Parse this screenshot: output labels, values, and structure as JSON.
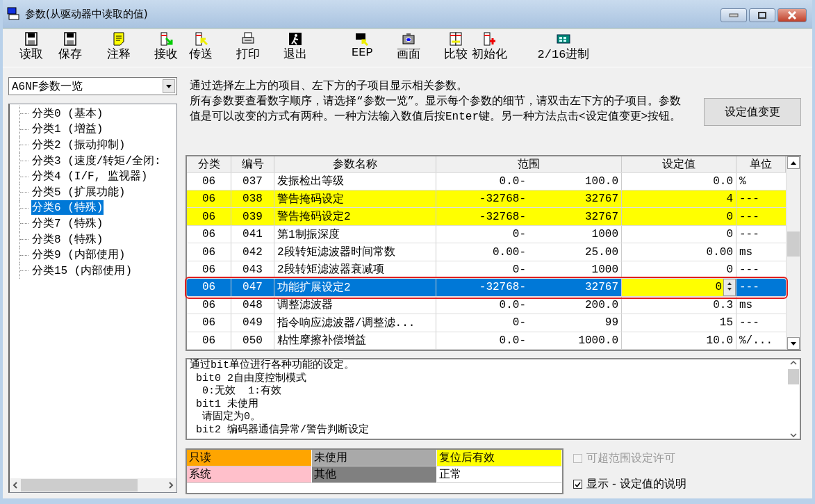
{
  "window": {
    "title": "参数(从驱动器中读取的值)"
  },
  "toolbar": [
    "读取",
    "保存",
    "注释",
    "接收",
    "传送",
    "打印",
    "退出",
    "EEP",
    "画面",
    "比较",
    "初始化",
    "2/16进制"
  ],
  "sidebar": {
    "dropdown": "A6NF参数一览",
    "tree": [
      {
        "label": "分类0 (基本)",
        "selected": false
      },
      {
        "label": "分类1 (增益)",
        "selected": false
      },
      {
        "label": "分类2 (振动抑制)",
        "selected": false
      },
      {
        "label": "分类3 (速度/转矩/全闭:",
        "selected": false
      },
      {
        "label": "分类4 (I/F, 监视器)",
        "selected": false
      },
      {
        "label": "分类5 (扩展功能)",
        "selected": false
      },
      {
        "label": "分类6 (特殊)",
        "selected": true
      },
      {
        "label": "分类7 (特殊)",
        "selected": false
      },
      {
        "label": "分类8 (特殊)",
        "selected": false
      },
      {
        "label": "分类9 (内部使用)",
        "selected": false
      },
      {
        "label": "分类15 (内部使用)",
        "selected": false
      }
    ]
  },
  "instructions": [
    "通过选择左上方的项目、左下方的子项目显示相关参数。",
    "所有参数要查看数字顺序，请选择“参数一览”。显示每个参数的细节，请双击左下方的子项目。参数值是可以改变的方式有两种。一种方法输入数值后按Enter键。另一种方法点击<设定值变更>按钮。"
  ],
  "change_button": "设定值变更",
  "table": {
    "columns": [
      "分类",
      "编号",
      "参数名称",
      "范围",
      "设定值",
      "单位"
    ],
    "rows": [
      {
        "group": "06",
        "number": "037",
        "name": "发振检出等级",
        "min": "0.0-",
        "max": "100.0",
        "value": "0.0",
        "unit": "%",
        "reset_effective": false,
        "selected": false
      },
      {
        "group": "06",
        "number": "038",
        "name": "警告掩码设定",
        "min": "-32768-",
        "max": "32767",
        "value": "4",
        "unit": "---",
        "reset_effective": true,
        "selected": false
      },
      {
        "group": "06",
        "number": "039",
        "name": "警告掩码设定2",
        "min": "-32768-",
        "max": "32767",
        "value": "0",
        "unit": "---",
        "reset_effective": true,
        "selected": false
      },
      {
        "group": "06",
        "number": "041",
        "name": "第1制振深度",
        "min": "0-",
        "max": "1000",
        "value": "0",
        "unit": "---",
        "reset_effective": false,
        "selected": false
      },
      {
        "group": "06",
        "number": "042",
        "name": "2段转矩滤波器时间常数",
        "min": "0.00-",
        "max": "25.00",
        "value": "0.00",
        "unit": "ms",
        "reset_effective": false,
        "selected": false
      },
      {
        "group": "06",
        "number": "043",
        "name": "2段转矩滤波器衰减项",
        "min": "0-",
        "max": "1000",
        "value": "0",
        "unit": "---",
        "reset_effective": false,
        "selected": false
      },
      {
        "group": "06",
        "number": "047",
        "name": "功能扩展设定2",
        "min": "-32768-",
        "max": "32767",
        "value": "0",
        "unit": "---",
        "selected": true
      },
      {
        "group": "06",
        "number": "048",
        "name": "调整滤波器",
        "min": "0.0-",
        "max": "200.0",
        "value": "0.3",
        "unit": "ms",
        "reset_effective": false,
        "selected": false
      },
      {
        "group": "06",
        "number": "049",
        "name": "指令响应滤波器/调整滤...",
        "min": "0-",
        "max": "99",
        "value": "15",
        "unit": "---",
        "reset_effective": false,
        "selected": false
      },
      {
        "group": "06",
        "number": "050",
        "name": "粘性摩擦补偿增益",
        "min": "0.0-",
        "max": "1000.0",
        "value": "10.0",
        "unit": "%/...",
        "reset_effective": false,
        "selected": false
      }
    ]
  },
  "description": [
    "通过bit单位进行各种功能的设定。",
    " bit0 2自由度控制模式",
    "  0:无效  1:有效",
    " bit1 未使用",
    "  请固定为0。",
    " bit2 编码器通信异常/警告判断设定"
  ],
  "legend": [
    {
      "label": "只读",
      "color": "#ffa500"
    },
    {
      "label": "未使用",
      "color": "#a9a9a9"
    },
    {
      "label": "复位后有效",
      "color": "#ffff00"
    },
    {
      "label": "系统",
      "color": "#ffc0cb"
    },
    {
      "label": "其他",
      "color": "#808080"
    },
    {
      "label": "正常",
      "color": "#ffffff"
    }
  ],
  "options": [
    {
      "label": "可超范围设定许可",
      "checked": false,
      "disabled": true
    },
    {
      "label": "显示 - 设定值的说明",
      "checked": true,
      "disabled": false
    }
  ]
}
